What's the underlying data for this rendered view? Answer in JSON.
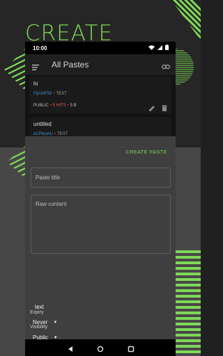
{
  "promo": {
    "title": "CREATE"
  },
  "status_bar": {
    "time": "10:00"
  },
  "app_bar": {
    "title": "All Pastes"
  },
  "pastes": [
    {
      "name": "hi",
      "id": "FipUhF58",
      "syntax": "TEXT",
      "visibility": "PUBLIC",
      "hits": "5 HITS",
      "size": "5 B"
    },
    {
      "name": "untitled",
      "id": "eCPbrahU",
      "syntax": "TEXT"
    }
  ],
  "sheet": {
    "create_label": "CREATE PASTE",
    "title_placeholder": "Paste title",
    "content_placeholder": "Raw content",
    "syntax": "text",
    "visibility_label": "Visibility",
    "visibility_value": "Public",
    "expiry_label": "Expiry",
    "expiry_value": "Never"
  },
  "icons": [
    "menu-icon",
    "link-icon",
    "wifi-icon",
    "signal-icon",
    "battery-icon",
    "edit-icon",
    "delete-icon",
    "back-icon",
    "home-icon",
    "recents-icon"
  ],
  "colors": {
    "accent": "#7ed957",
    "id_link": "#3a8fd6",
    "dot": "#e53935",
    "hits": "#e4634d"
  }
}
